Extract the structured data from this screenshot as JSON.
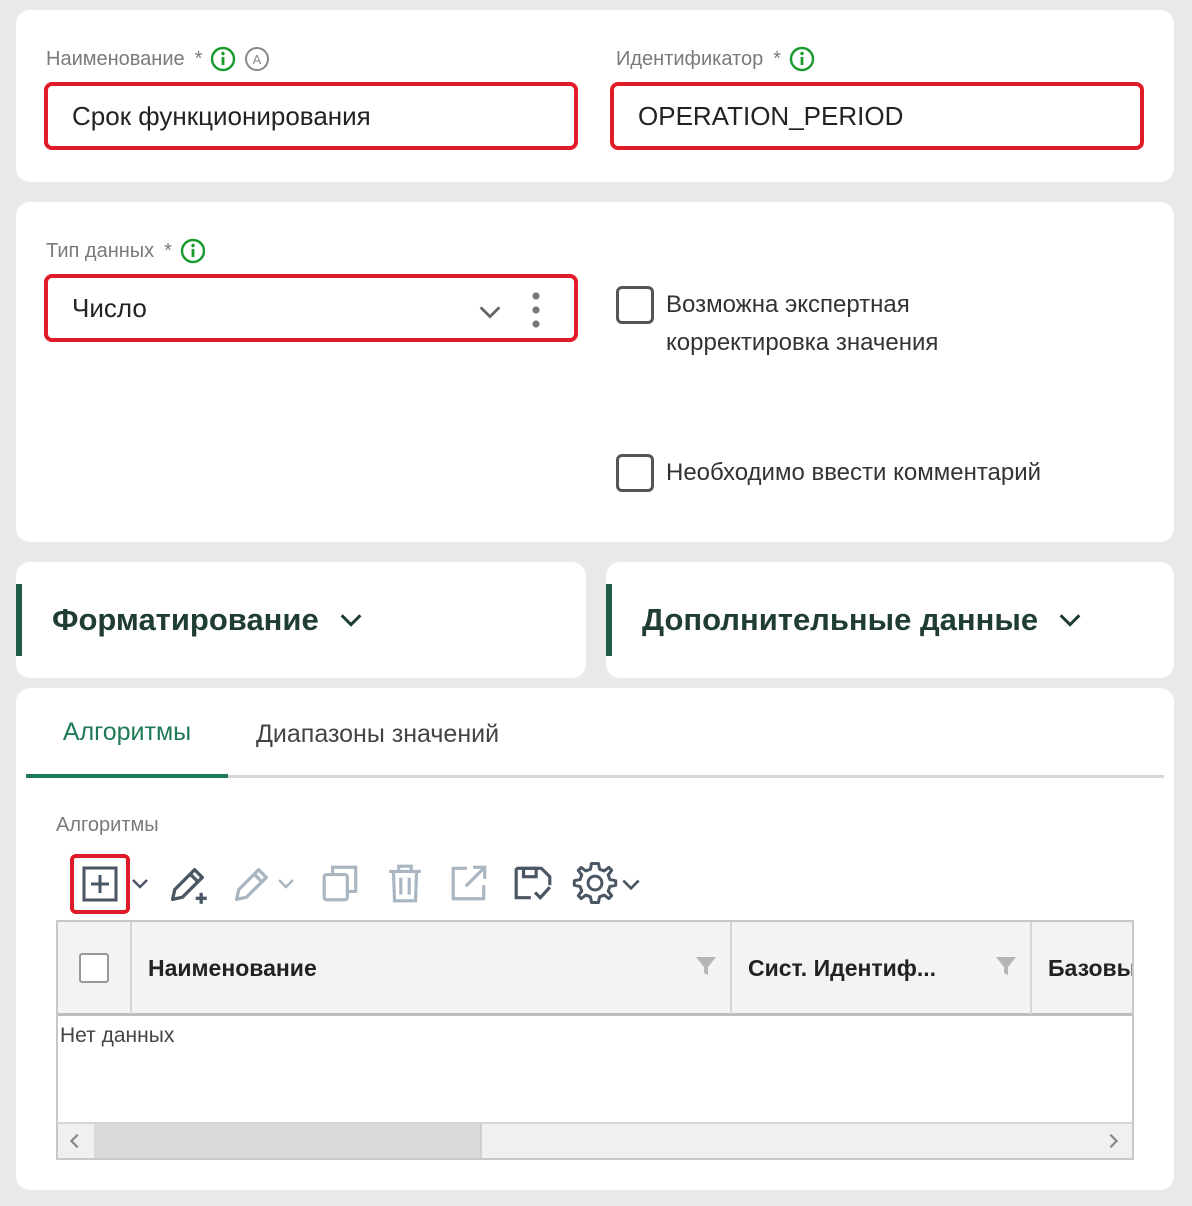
{
  "form": {
    "name_label": "Наименование",
    "name_required": "*",
    "name_value": "Срок функционирования",
    "id_label": "Идентификатор",
    "id_required": "*",
    "id_value": "OPERATION_PERIOD",
    "type_label": "Тип данных",
    "type_required": "*",
    "type_value": "Число",
    "checkbox_expert": "Возможна экспертная корректировка значения",
    "checkbox_comment": "Необходимо ввести комментарий"
  },
  "sections": {
    "formatting": "Форматирование",
    "additional": "Дополнительные данные"
  },
  "tabs": [
    {
      "label": "Алгоритмы",
      "active": true
    },
    {
      "label": "Диапазоны значений",
      "active": false
    }
  ],
  "algorithms": {
    "section_label": "Алгоритмы",
    "toolbar": [
      "add-icon",
      "edit-add-icon",
      "edit-icon",
      "copy-icon",
      "delete-icon",
      "export-icon",
      "save-icon",
      "settings-icon"
    ],
    "columns": [
      "Наименование",
      "Сист. Идентиф...",
      "Базовы"
    ],
    "empty_text": "Нет данных"
  },
  "colors": {
    "accent_green": "#1e7a55",
    "highlight_red": "#e01b2a",
    "info_green": "#1a9a2a"
  }
}
